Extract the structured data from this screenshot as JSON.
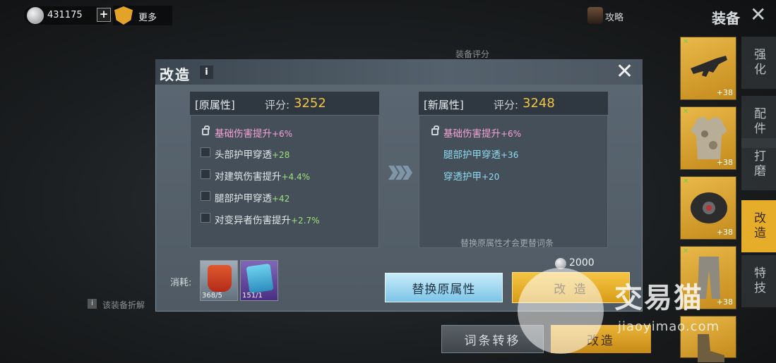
{
  "topbar": {
    "currency_value": "431175",
    "plus_label": "+",
    "more_label": "更多",
    "guide_label": "攻略",
    "title": "装备",
    "close_icon": "close-icon"
  },
  "side_tabs": [
    {
      "label": "强化",
      "active": false
    },
    {
      "label": "配件",
      "active": false
    },
    {
      "label": "打磨",
      "active": false
    },
    {
      "label": "改造",
      "active": true
    },
    {
      "label": "特技",
      "active": false
    }
  ],
  "item_cards": [
    {
      "icon": "rifle-icon",
      "level": "+38"
    },
    {
      "icon": "camo-jacket-icon",
      "level": "+38"
    },
    {
      "icon": "helmet-icon",
      "level": "+38"
    },
    {
      "icon": "pants-icon",
      "level": "+38"
    },
    {
      "icon": "boots-icon",
      "level": ""
    }
  ],
  "background": {
    "score_label": "装备评分",
    "note": "该装备折解",
    "transfer_button": "词条转移",
    "modify_button": "改造"
  },
  "modal": {
    "title": "改造",
    "info_label": "i",
    "original": {
      "tag": "[原属性]",
      "score_label": "评分:",
      "score": "3252",
      "attrs": [
        {
          "name": "基础伤害提升",
          "value": "+6%",
          "locked": true
        },
        {
          "name": "头部护甲穿透",
          "value": "+28",
          "locked": false
        },
        {
          "name": "对建筑伤害提升",
          "value": "+4.4%",
          "locked": false
        },
        {
          "name": "腿部护甲穿透",
          "value": "+42",
          "locked": false
        },
        {
          "name": "对变异者伤害提升",
          "value": "+2.7%",
          "locked": false
        }
      ]
    },
    "new": {
      "tag": "[新属性]",
      "score_label": "评分:",
      "score": "3248",
      "attrs": [
        {
          "name": "基础伤害提升",
          "value": "+6%",
          "locked": true
        },
        {
          "name": "腿部护甲穿透",
          "value": "+36",
          "locked": false
        },
        {
          "name": "穿透护甲",
          "value": "+20",
          "locked": false
        }
      ],
      "hint": "替换原属性才会更替词条"
    },
    "cost_label": "消耗:",
    "materials": [
      {
        "icon": "red-backpack-icon",
        "count": "368/5"
      },
      {
        "icon": "blue-cube-icon",
        "count": "151/1"
      }
    ],
    "replace_button": "替换原属性",
    "modify_button": "改 造",
    "modify_cost": "2000"
  },
  "watermark": {
    "text": "交易猫",
    "url": "jiaoyimao.com"
  },
  "colors": {
    "accent_gold": "#e6ad2a",
    "score_gold": "#f2c443",
    "locked_attr": "#f6a2d6",
    "value_green": "#9fe07a",
    "new_attr": "#8fdcf2"
  }
}
